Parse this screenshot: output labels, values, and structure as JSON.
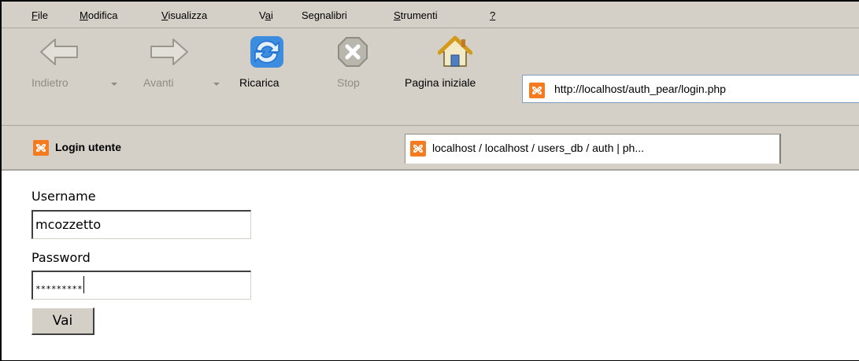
{
  "menu": {
    "items": [
      {
        "accel": "F",
        "rest": "ile"
      },
      {
        "accel": "M",
        "rest": "odifica"
      },
      {
        "accel": "V",
        "rest": "isualizza"
      },
      {
        "pre": "V",
        "accel": "a",
        "rest": "i"
      },
      {
        "pre": "Se",
        "accel": "g",
        "rest": "nalibri"
      },
      {
        "accel": "S",
        "rest": "trumenti"
      },
      {
        "accel": "?",
        "rest": ""
      }
    ]
  },
  "toolbar": {
    "back_label": "Indietro",
    "forward_label": "Avanti",
    "reload_label": "Ricarica",
    "stop_label": "Stop",
    "home_label": "Pagina iniziale"
  },
  "address_bar": {
    "url": "http://localhost/auth_pear/login.php"
  },
  "tabs": [
    {
      "label": "Login utente",
      "active": true
    },
    {
      "label": "localhost / localhost / users_db  / auth | ph...",
      "active": false
    }
  ],
  "form": {
    "username_label": "Username",
    "username_value": "mcozzetto",
    "password_label": "Password",
    "password_value": "*********",
    "submit_label": "Vai"
  },
  "colors": {
    "chrome": "#d4d0c8",
    "favicon": "#f47b20",
    "reload_icon": "#1e6fd0"
  }
}
